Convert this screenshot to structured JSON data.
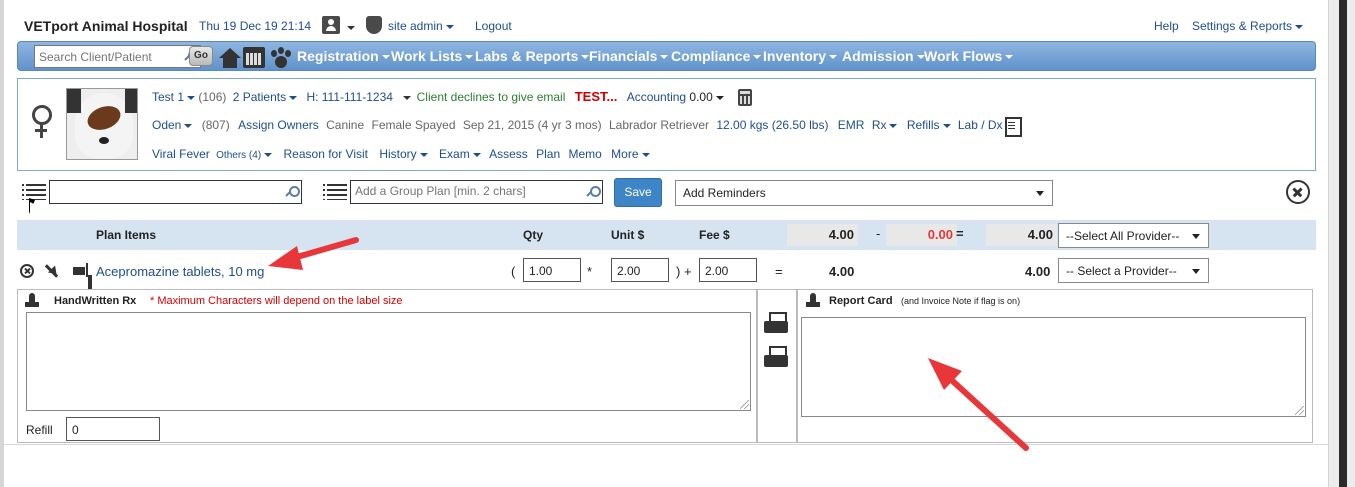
{
  "topbar": {
    "brand": "VETport Animal Hospital",
    "datetime": "Thu 19 Dec 19 21:14",
    "user_label": "site admin",
    "logout": "Logout",
    "help": "Help",
    "settings": "Settings & Reports"
  },
  "nav": {
    "search_placeholder": "Search Client/Patient",
    "go": "Go",
    "menus": [
      "Registration",
      "Work Lists",
      "Labs & Reports",
      "Financials",
      "Compliance",
      "Inventory",
      "Admission",
      "Work Flows"
    ]
  },
  "patient": {
    "row1": {
      "client": "Test 1",
      "client_count": "(106)",
      "patients": "2  Patients",
      "phone": "H: 111-111-1234",
      "email_note": "Client declines to give email",
      "alert": "TEST...",
      "accounting": "Accounting",
      "balance": "0.00"
    },
    "row2": {
      "pet": "Oden",
      "pet_count": "(807)",
      "assign_owners": "Assign Owners",
      "species": "Canine",
      "sex": "Female Spayed",
      "dob": "Sep 21, 2015 (4 yr 3 mos)",
      "breed": "Labrador Retriever",
      "weight": "12.00 kgs (26.50 lbs)",
      "emr": "EMR",
      "rx": "Rx",
      "refills": "Refills",
      "lab": "Lab / Dx"
    },
    "row3": {
      "problem": "Viral Fever",
      "others": "Others (4)",
      "reason": "Reason for Visit",
      "history": "History",
      "exam": "Exam",
      "assess": "Assess",
      "plan": "Plan",
      "memo": "Memo",
      "more": "More"
    }
  },
  "plan_controls": {
    "item_search_value": "",
    "group_plan_placeholder": "Add a Group Plan [min. 2 chars]",
    "save": "Save",
    "reminders": "Add Reminders"
  },
  "plan_header": {
    "items": "Plan Items",
    "qty": "Qty",
    "unit": "Unit $",
    "fee": "Fee $",
    "total": "4.00",
    "minus": "-",
    "discount": "0.00",
    "equals": "=",
    "net": "4.00",
    "provider_all": "--Select All Provider--"
  },
  "plan_item": {
    "name": "Acepromazine tablets, 10 mg",
    "open_paren": "(",
    "qty": "1.00",
    "times": "*",
    "unit": "2.00",
    "close_plus": ")  +",
    "fee": "2.00",
    "equals": "=",
    "subtotal": "4.00",
    "total": "4.00",
    "provider": "-- Select a Provider--"
  },
  "handwritten": {
    "title": "HandWritten Rx",
    "note": "* Maximum Characters will depend on the label size",
    "refill_label": "Refill",
    "refill_value": "0"
  },
  "report_card": {
    "title": "Report Card",
    "note": "(and Invoice Note if flag is on)"
  },
  "colors": {
    "nav_blue": "#6f9fd5",
    "link": "#1f4e8c",
    "alert_red": "#d10000",
    "arrow_red": "#e8373a",
    "save_blue": "#3d85c6"
  }
}
